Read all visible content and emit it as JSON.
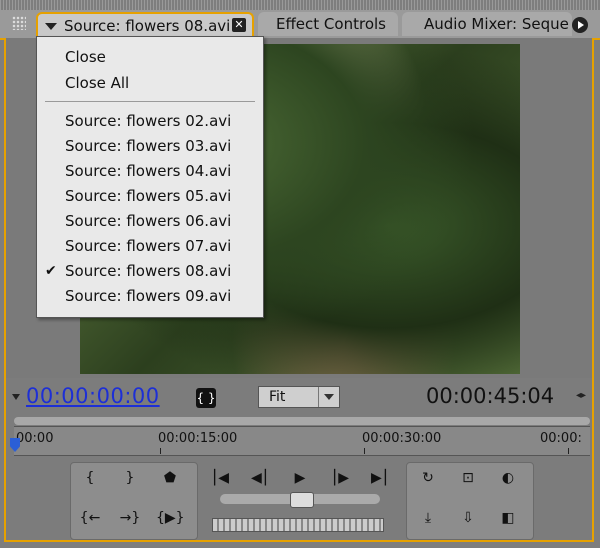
{
  "tabs": {
    "active_label": "Source: flowers 08.avi",
    "close_glyph": "✕",
    "effect_controls_label": "Effect Controls",
    "audio_mixer_label": "Audio Mixer: Seque"
  },
  "dropdown": {
    "close_label": "Close",
    "close_all_label": "Close All",
    "items": [
      "Source: flowers 02.avi",
      "Source: flowers 03.avi",
      "Source: flowers 04.avi",
      "Source: flowers 05.avi",
      "Source: flowers 06.avi",
      "Source: flowers 07.avi",
      "Source: flowers 08.avi",
      "Source: flowers 09.avi"
    ],
    "checked_index": 6,
    "check_glyph": "✔"
  },
  "monitor": {
    "current_time": "00:00:00:00",
    "duration": "00:00:45:04",
    "zoom": "Fit",
    "mark_glyph": "{ }",
    "duration_arrows": "◂▸"
  },
  "ruler": {
    "labels": [
      "00:00",
      "00:00:15:00",
      "00:00:30:00",
      "00:00:"
    ]
  },
  "transport": {
    "mark_in_glyph": "{",
    "mark_out_glyph": "}",
    "marker_glyph": "⬟",
    "goto_in_glyph": "{←",
    "goto_out_glyph": "→}",
    "play_in_out_glyph": "{▶}",
    "step_back_glyph": "⎮◀",
    "prev_frame_glyph": "◀⎮",
    "play_glyph": "▶",
    "next_frame_glyph": "⎮▶",
    "step_fwd_glyph": "▶⎮",
    "loop_glyph": "↻",
    "safe_margins_glyph": "⊡",
    "output_glyph": "◐",
    "insert_glyph": "⤓",
    "overlay_glyph": "⇩",
    "export_glyph": "◧"
  },
  "colors": {
    "accent": "#e6a100",
    "timecode_link": "#1d2fd6",
    "playhead": "#2b5fd6"
  }
}
